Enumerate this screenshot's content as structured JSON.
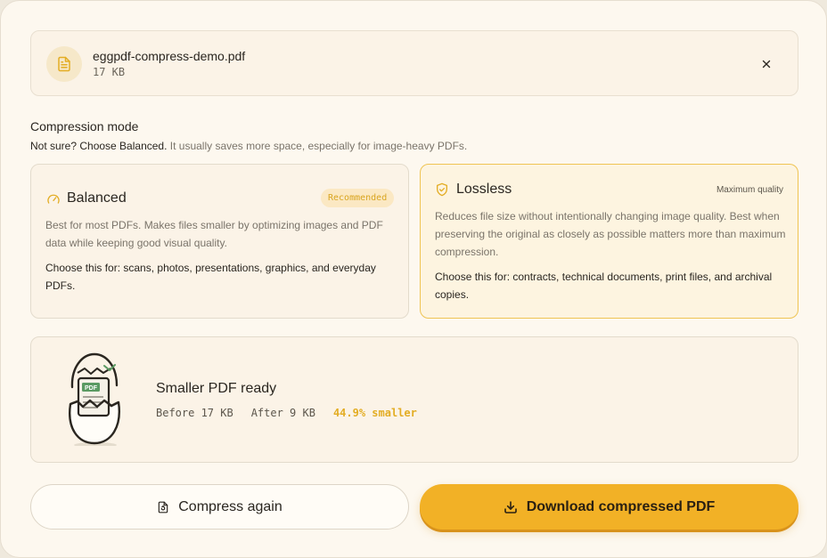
{
  "file": {
    "name": "eggpdf-compress-demo.pdf",
    "size": "17 KB",
    "icon": "document-icon",
    "remove_icon": "close-icon"
  },
  "mode": {
    "title": "Compression mode",
    "hint_strong": "Not sure? Choose Balanced.",
    "hint_rest": " It usually saves more space, especially for image-heavy PDFs.",
    "selected": "lossless",
    "options": [
      {
        "id": "balanced",
        "icon": "gauge-icon",
        "title": "Balanced",
        "badge": "Recommended",
        "description": "Best for most PDFs. Makes files smaller by optimizing images and PDF data while keeping good visual quality.",
        "choose_for": "Choose this for: scans, photos, presentations, graphics, and everyday PDFs."
      },
      {
        "id": "lossless",
        "icon": "shield-check-icon",
        "title": "Lossless",
        "tag": "Maximum quality",
        "description": "Reduces file size without intentionally changing image quality. Best when preserving the original as closely as possible matters more than maximum compression.",
        "choose_for": "Choose this for: contracts, technical documents, print files, and archival copies."
      }
    ]
  },
  "result": {
    "illustration": "hatching-egg-pdf-illustration",
    "title": "Smaller PDF ready",
    "before": "Before 17 KB",
    "after": "After 9 KB",
    "saved": "44.9% smaller",
    "illustration_label": "PDF"
  },
  "actions": {
    "compress_again": "Compress again",
    "compress_again_icon": "file-refresh-icon",
    "download": "Download compressed PDF",
    "download_icon": "download-icon"
  },
  "colors": {
    "accent": "#f2b126",
    "accent_text": "#e3ad24",
    "panel": "#fdf8ef",
    "selected_border": "#efc453"
  }
}
